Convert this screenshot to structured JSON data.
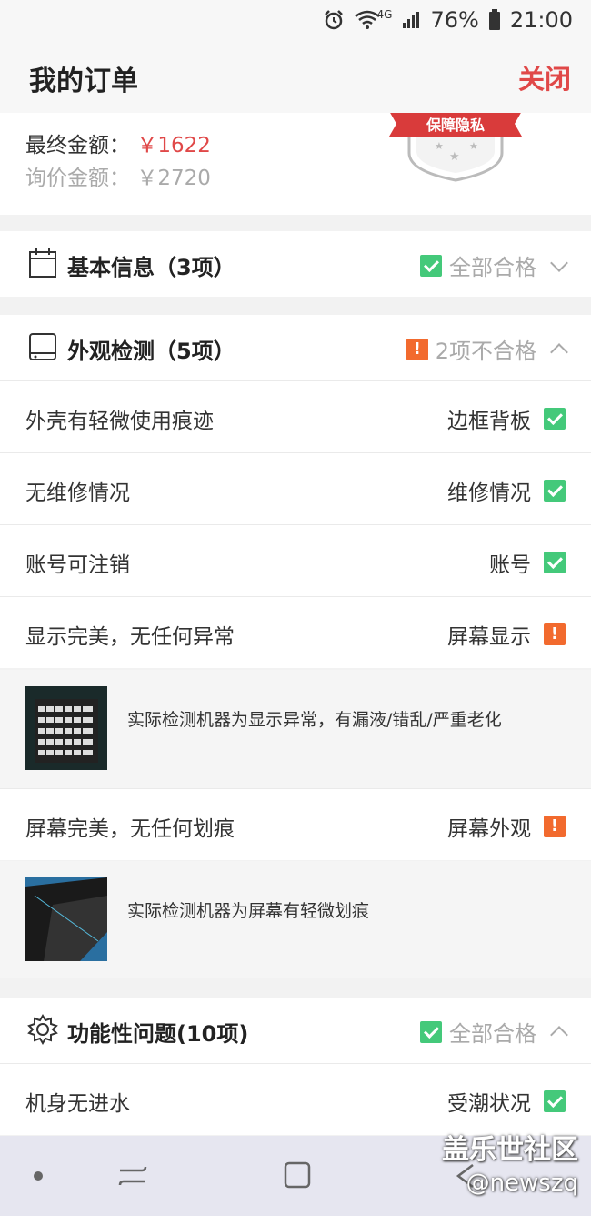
{
  "status_bar": {
    "battery": "76%",
    "time": "21:00",
    "network": "4G"
  },
  "header": {
    "title": "我的订单",
    "close_label": "关闭"
  },
  "price": {
    "final_label": "最终金额：",
    "final_value": "￥1622",
    "quote_label": "询价金额：",
    "quote_value": "￥2720",
    "badge_text": "保障隐私"
  },
  "sections": {
    "basic": {
      "title": "基本信息（3项）",
      "status": "全部合格"
    },
    "appearance": {
      "title": "外观检测（5项）",
      "status": "2项不合格",
      "rows": [
        {
          "left": "外壳有轻微使用痕迹",
          "right": "边框背板",
          "result": "pass"
        },
        {
          "left": "无维修情况",
          "right": "维修情况",
          "result": "pass"
        },
        {
          "left": "账号可注销",
          "right": "账号",
          "result": "pass"
        },
        {
          "left": "显示完美，无任何异常",
          "right": "屏幕显示",
          "result": "fail"
        },
        {
          "left": "屏幕完美，无任何划痕",
          "right": "屏幕外观",
          "result": "fail"
        }
      ],
      "notes": [
        "实际检测机器为显示异常，有漏液/错乱/严重老化",
        "实际检测机器为屏幕有轻微划痕"
      ]
    },
    "function": {
      "title": "功能性问题(10项)",
      "status": "全部合格",
      "rows": [
        {
          "left": "机身无进水",
          "right": "受潮状况",
          "result": "pass"
        }
      ]
    }
  },
  "watermark": {
    "line1": "盖乐世社区",
    "line2": "@newszq"
  },
  "icons": {
    "alarm": "alarm-icon",
    "wifi": "wifi-icon",
    "signal": "signal-icon",
    "battery": "battery-icon",
    "calendar": "calendar-icon",
    "tablet": "tablet-icon",
    "gear": "gear-icon",
    "check": "check-icon",
    "warning": "warning-icon"
  },
  "colors": {
    "accent_red": "#e04848",
    "pass_green": "#44c97a",
    "fail_orange": "#f26a2e"
  }
}
